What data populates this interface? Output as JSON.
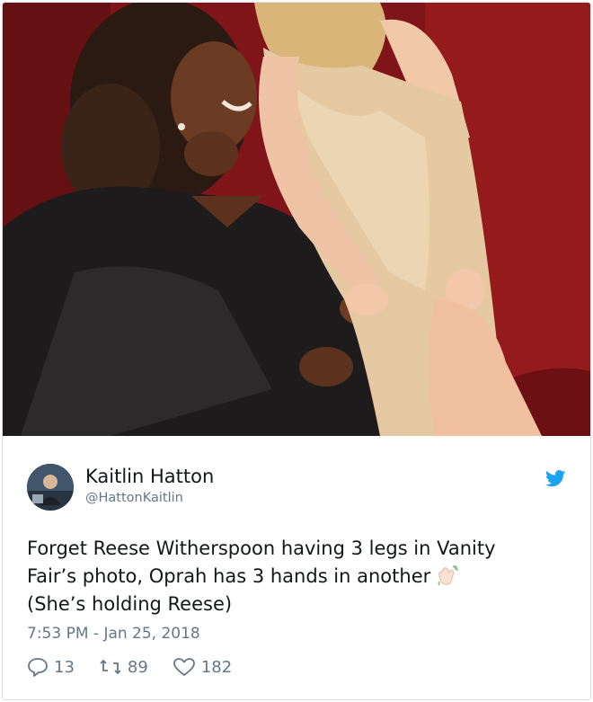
{
  "tweet": {
    "author_name": "Kaitlin Hatton",
    "author_handle": "@HattonKaitlin",
    "text_lines": [
      "Forget Reese Witherspoon having 3 legs in Vanity",
      "Fair’s photo, Oprah has 3 hands in another",
      "(She’s holding Reese)"
    ],
    "timestamp": "7:53 PM - Jan 25, 2018",
    "reply_count": "13",
    "retweet_count": "89",
    "like_count": "182"
  },
  "icons": {
    "brand": "twitter-bird-icon",
    "emoji": "waving-hand-emoji",
    "reply": "reply-icon",
    "retweet": "retweet-icon",
    "like": "heart-icon"
  },
  "colors": {
    "twitter_blue": "#1da1f2",
    "text_primary": "#14171a",
    "text_secondary": "#657786",
    "photo_background": "#8f1b1c"
  }
}
